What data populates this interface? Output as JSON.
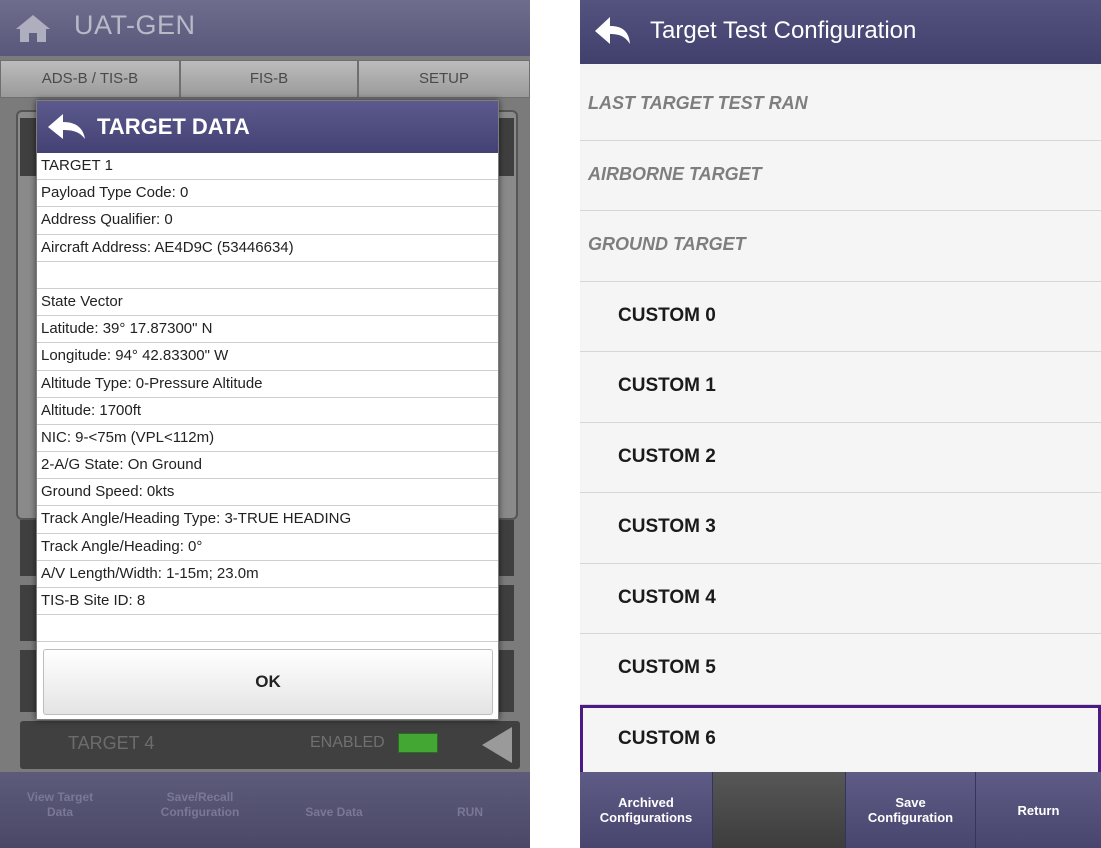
{
  "left": {
    "app_title": "UAT-GEN",
    "tabs": [
      "ADS-B / TIS-B",
      "FIS-B",
      "SETUP"
    ],
    "target_row": {
      "label": "TARGET 4",
      "status": "ENABLED"
    },
    "bottom_buttons": [
      {
        "label": "View Target\nData"
      },
      {
        "label": "Save/Recall\nConfiguration"
      },
      {
        "label": "Save Data"
      },
      {
        "label": "RUN"
      }
    ],
    "dialog": {
      "title": "TARGET DATA",
      "rows": [
        "TARGET 1",
        "Payload Type Code: 0",
        "Address Qualifier: 0",
        "Aircraft Address: AE4D9C (53446634)",
        "",
        "State Vector",
        "Latitude: 39° 17.87300\" N",
        "Longitude: 94° 42.83300\" W",
        "Altitude Type: 0-Pressure Altitude",
        "Altitude: 1700ft",
        "NIC: 9-<75m (VPL<112m)",
        "2-A/G State: On Ground",
        "Ground Speed: 0kts",
        "Track Angle/Heading Type: 3-TRUE HEADING",
        "Track Angle/Heading: 0°",
        "A/V Length/Width: 1-15m; 23.0m",
        "TIS-B Site ID: 8",
        ""
      ],
      "ok_label": "OK"
    }
  },
  "right": {
    "title": "Target Test Configuration",
    "items": [
      {
        "label": "LAST TARGET TEST RAN",
        "kind": "preset"
      },
      {
        "label": "AIRBORNE TARGET",
        "kind": "preset"
      },
      {
        "label": "GROUND TARGET",
        "kind": "preset"
      },
      {
        "label": "CUSTOM 0",
        "kind": "custom"
      },
      {
        "label": "CUSTOM 1",
        "kind": "custom"
      },
      {
        "label": "CUSTOM 2",
        "kind": "custom"
      },
      {
        "label": "CUSTOM 3",
        "kind": "custom"
      },
      {
        "label": "CUSTOM 4",
        "kind": "custom"
      },
      {
        "label": "CUSTOM 5",
        "kind": "custom"
      },
      {
        "label": "CUSTOM 6",
        "kind": "custom",
        "selected": true
      }
    ],
    "bottom_buttons": [
      {
        "label": "Archived\nConfigurations"
      },
      {
        "label": ""
      },
      {
        "label": "Save\nConfiguration"
      },
      {
        "label": "Return"
      }
    ]
  },
  "colors": {
    "header_purple": "#4f4d7c",
    "selection_border": "#4a1a85",
    "enabled_green": "#43a833"
  },
  "icons": [
    "home-icon",
    "back-arrow-icon",
    "left-triangle-icon"
  ]
}
